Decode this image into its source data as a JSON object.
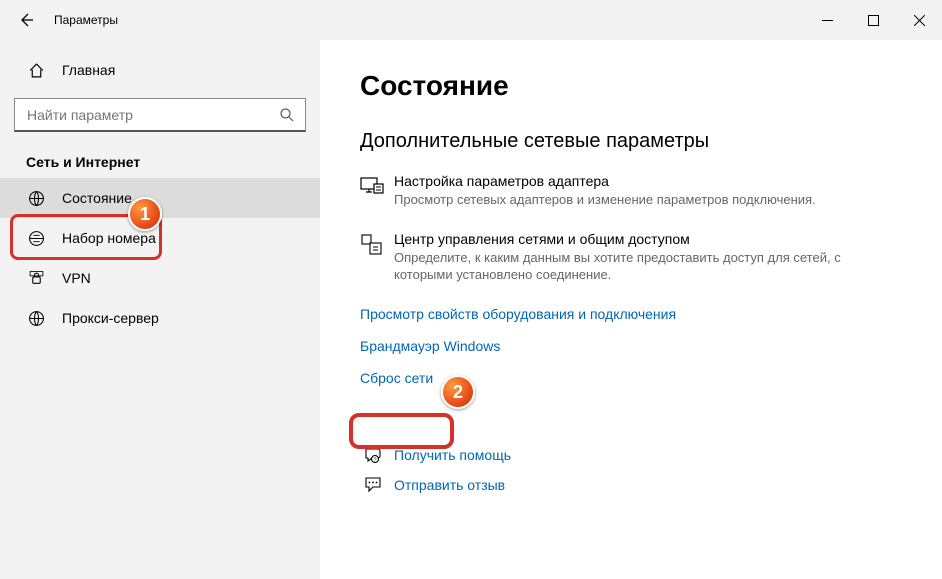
{
  "window": {
    "title": "Параметры"
  },
  "sidebar": {
    "home": "Главная",
    "search_placeholder": "Найти параметр",
    "category": "Сеть и Интернет",
    "items": [
      {
        "label": "Состояние"
      },
      {
        "label": "Набор номера"
      },
      {
        "label": "VPN"
      },
      {
        "label": "Прокси-сервер"
      }
    ]
  },
  "content": {
    "page_title": "Состояние",
    "section_title": "Дополнительные сетевые параметры",
    "adapter": {
      "title": "Настройка параметров адаптера",
      "desc": "Просмотр сетевых адаптеров и изменение параметров подключения."
    },
    "sharing": {
      "title": "Центр управления сетями и общим доступом",
      "desc": "Определите, к каким данным вы хотите предоставить доступ для сетей, с которыми установлено соединение."
    },
    "links": {
      "hw_props": "Просмотр свойств оборудования и подключения",
      "firewall": "Брандмауэр Windows",
      "reset": "Сброс сети"
    },
    "help": {
      "get_help": "Получить помощь",
      "feedback": "Отправить отзыв"
    }
  },
  "markers": {
    "m1": "1",
    "m2": "2"
  }
}
